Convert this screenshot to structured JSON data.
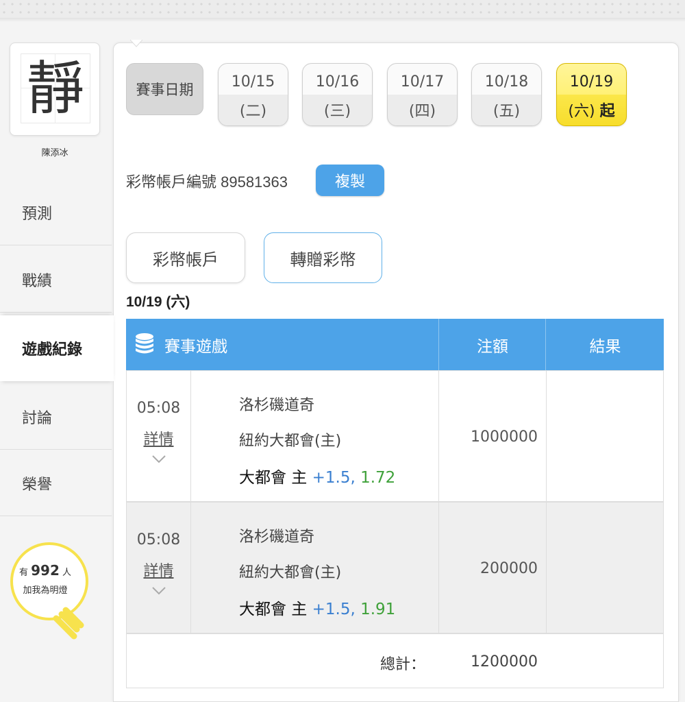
{
  "sidebar": {
    "avatar_char": "靜",
    "user_name": "陳添冰",
    "items": [
      {
        "label": "預測"
      },
      {
        "label": "戰績"
      },
      {
        "label": "遊戲紀錄"
      },
      {
        "label": "討論"
      },
      {
        "label": "榮譽"
      }
    ],
    "fans": {
      "prefix": "有",
      "count": "992",
      "suffix": "人",
      "cta": "加我為明燈"
    }
  },
  "dates": {
    "label": "賽事日期",
    "items": [
      {
        "date": "10/15",
        "weekday": "(二)"
      },
      {
        "date": "10/16",
        "weekday": "(三)"
      },
      {
        "date": "10/17",
        "weekday": "(四)"
      },
      {
        "date": "10/18",
        "weekday": "(五)"
      },
      {
        "date": "10/19",
        "weekday": "(六)",
        "badge": "起",
        "selected": true
      }
    ]
  },
  "account": {
    "label": "彩幣帳戶編號 89581363",
    "copy_label": "複製"
  },
  "tabs": [
    {
      "label": "彩幣帳戶"
    },
    {
      "label": "轉贈彩幣"
    }
  ],
  "day_heading": "10/19 (六)",
  "table": {
    "headers": {
      "game": "賽事遊戲",
      "amount": "注額",
      "result": "結果"
    },
    "rows": [
      {
        "time": "05:08",
        "detail": "詳情",
        "away": "洛杉磯道奇",
        "home": "紐約大都會(主)",
        "pick": "大都會 主",
        "handicap": "+1.5,",
        "odds": "1.72",
        "amount": "1000000",
        "result": ""
      },
      {
        "time": "05:08",
        "detail": "詳情",
        "away": "洛杉磯道奇",
        "home": "紐約大都會(主)",
        "pick": "大都會 主",
        "handicap": "+1.5,",
        "odds": "1.91",
        "amount": "200000",
        "result": ""
      }
    ],
    "total_label": "總計：",
    "total_value": "1200000"
  },
  "colors": {
    "accent": "#4da3e8",
    "selected_date": "#fbe74a",
    "handicap": "#3a7fd0",
    "odds": "#3fa13a"
  }
}
